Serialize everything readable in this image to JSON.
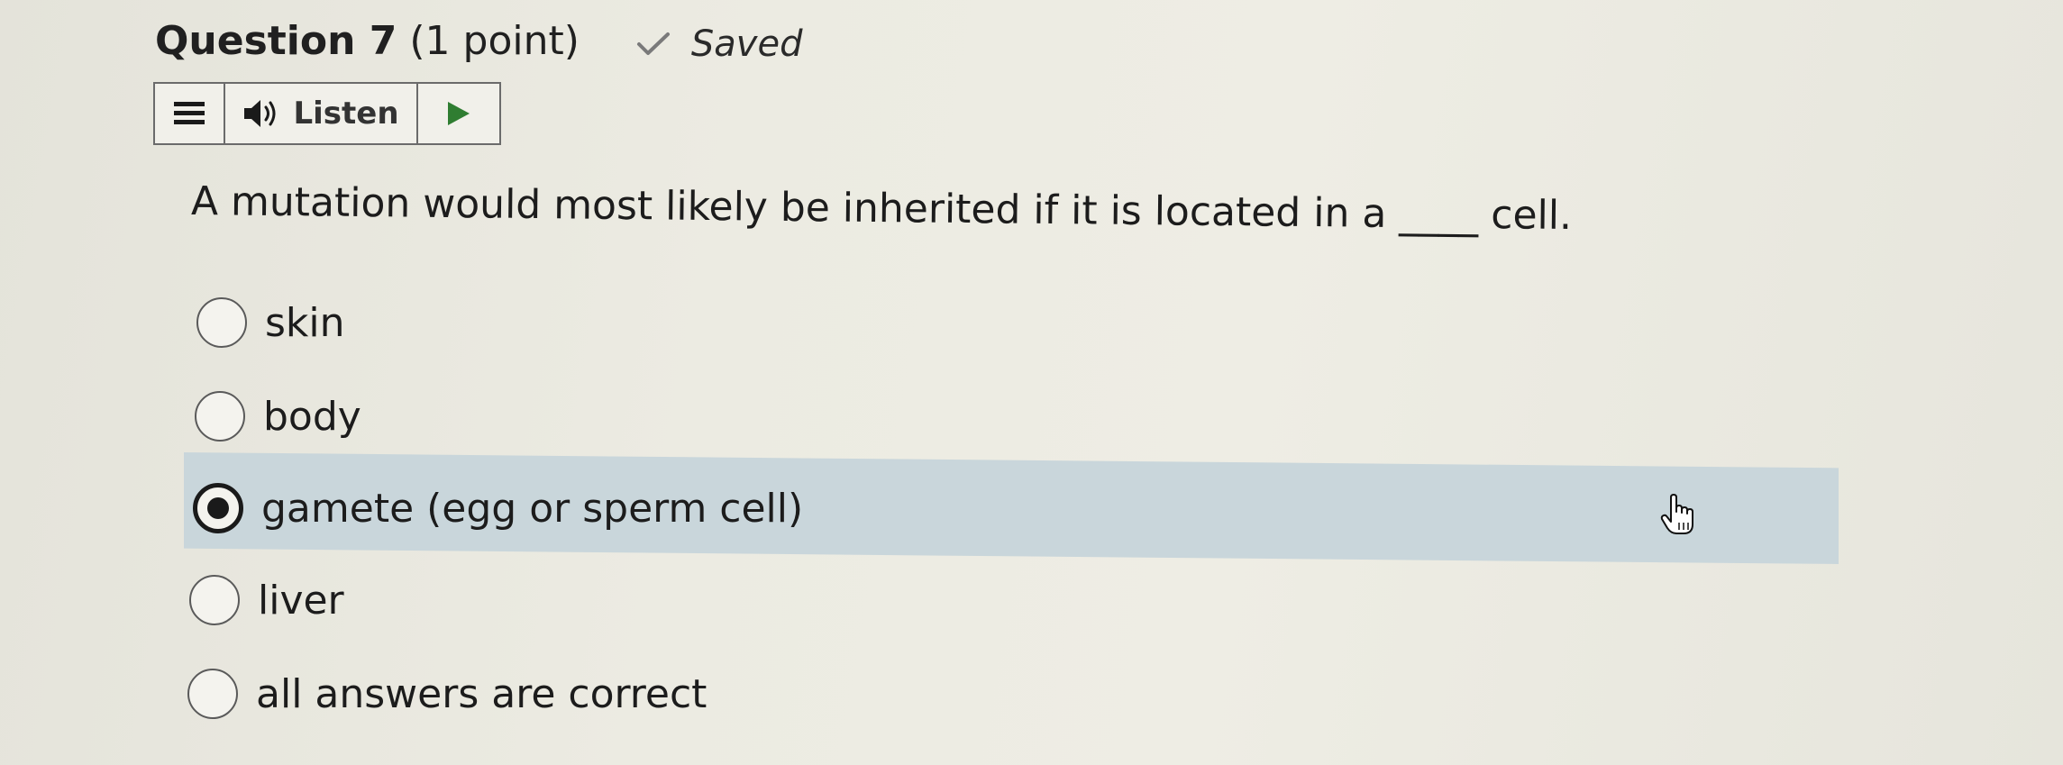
{
  "question": {
    "title": "Question 7",
    "points": "(1 point)",
    "saved_label": "Saved",
    "text": "A mutation would most likely be inherited if it is located in a ____ cell."
  },
  "toolbar": {
    "menu_icon": "menu-icon",
    "listen_icon": "speaker-icon",
    "listen_label": "Listen",
    "play_icon": "play-icon"
  },
  "options": [
    {
      "label": "skin",
      "selected": false
    },
    {
      "label": "body",
      "selected": false
    },
    {
      "label": "gamete (egg or sperm cell)",
      "selected": true
    },
    {
      "label": "liver",
      "selected": false
    },
    {
      "label": "all answers are correct",
      "selected": false
    }
  ],
  "colors": {
    "selected_row": "#c9d6db",
    "play_green": "#2f7d31",
    "background": "#ecebe2"
  }
}
